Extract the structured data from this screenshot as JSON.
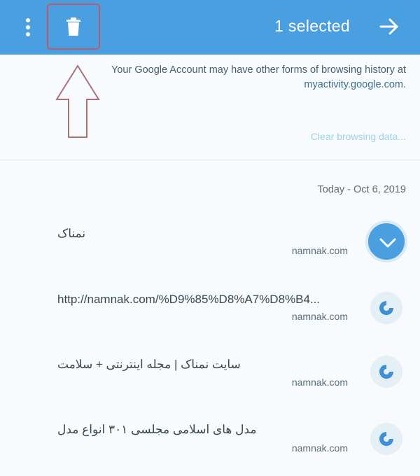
{
  "topbar": {
    "selection_label": "1 selected",
    "menu_icon": "more-vert-icon",
    "delete_icon": "trash-icon",
    "forward_icon": "arrow-right-icon",
    "color": "#4a9fe0"
  },
  "notice": {
    "line1": "Your Google Account may have other forms of browsing history at",
    "link": "myactivity.google.com."
  },
  "clear_browsing_data": "Clear browsing data...",
  "date_header": "Today - Oct 6, 2019",
  "history": [
    {
      "title": "نمناک",
      "domain": "namnak.com",
      "selected": true
    },
    {
      "title": "http://namnak.com/%D9%85%D8%A7%D8%B4...",
      "domain": "namnak.com",
      "selected": false
    },
    {
      "title": "سایت نمناک | مجله اینترنتی + سلامت",
      "domain": "namnak.com",
      "selected": false
    },
    {
      "title": "مدل های اسلامی مجلسی ۳۰۱ انواع مدل",
      "domain": "namnak.com",
      "selected": false
    }
  ]
}
